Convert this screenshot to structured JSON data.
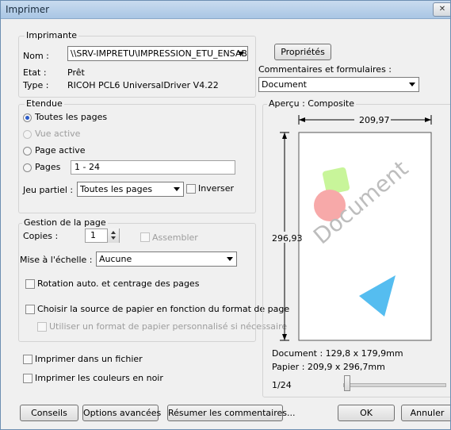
{
  "window": {
    "title": "Imprimer",
    "close_glyph": "✕"
  },
  "printer": {
    "group_label": "Imprimante",
    "name_label": "Nom :",
    "name_value": "\\\\SRV-IMPRETU\\IMPRESSION_ETU_ENSAB",
    "status_label": "Etat :",
    "status_value": "Prêt",
    "type_label": "Type :",
    "type_value": "RICOH PCL6 UniversalDriver V4.22",
    "properties_button": "Propriétés",
    "comments_label": "Commentaires et formulaires :",
    "comments_value": "Document"
  },
  "range": {
    "group_label": "Etendue",
    "all_pages": "Toutes les pages",
    "current_view": "Vue active",
    "current_page": "Page active",
    "pages": "Pages",
    "pages_value": "1 - 24",
    "subset_label": "Jeu partiel :",
    "subset_value": "Toutes les pages",
    "reverse_label": "Inverser"
  },
  "handling": {
    "group_label": "Gestion de la page",
    "copies_label": "Copies :",
    "copies_value": "1",
    "collate_label": "Assembler",
    "scaling_label": "Mise à l'échelle :",
    "scaling_value": "Aucune",
    "auto_rotate_label": "Rotation auto. et centrage des pages",
    "paper_source_label": "Choisir la source de papier en fonction du format de page",
    "custom_paper_label": "Utiliser un format de papier personnalisé si nécessaire"
  },
  "options": {
    "print_to_file": "Imprimer dans un fichier",
    "print_bw": "Imprimer les couleurs en noir"
  },
  "preview": {
    "label": "Aperçu : Composite",
    "width_dim": "209,97",
    "height_dim": "296,93",
    "watermark": "Document",
    "document_size": "Document : 129,8 x 179,9mm",
    "paper_size": "Papier : 209,9 x 296,7mm",
    "page_indicator": "1/24",
    "colors": {
      "green": "#c8f59a",
      "pink": "#f7a9a9",
      "blue": "#55bdf0"
    }
  },
  "footer": {
    "tips_button": "Conseils",
    "advanced_button": "Options avancées",
    "summarize_button": "Résumer les commentaires...",
    "ok_button": "OK",
    "cancel_button": "Annuler"
  }
}
